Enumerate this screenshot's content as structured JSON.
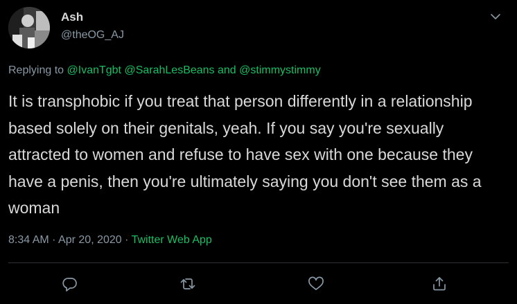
{
  "user": {
    "display_name": "Ash",
    "handle": "@theOG_AJ"
  },
  "reply_context": {
    "prefix": "Replying to ",
    "mention_1": "@IvanTgbt",
    "mention_2": "@SarahLesBeans",
    "conjunction": " and ",
    "mention_3": "@stimmystimmy"
  },
  "tweet": {
    "text": "It is transphobic if you treat that person differently in a relationship based solely on their genitals, yeah. If you say you're sexually attracted to women and refuse to have sex with one because they have a penis, then you're ultimately saying you don't see them as a woman",
    "time": "8:34 AM",
    "separator_1": " · ",
    "date": "Apr 20, 2020",
    "separator_2": " · ",
    "source": "Twitter Web App"
  },
  "icons": {
    "caret": "chevron-down-icon",
    "reply": "reply-bubble-icon",
    "retweet": "retweet-icon",
    "like": "heart-icon",
    "share": "share-upload-icon"
  },
  "colors": {
    "background": "#000000",
    "text": "#d9d9d9",
    "muted": "#8899a6",
    "accent": "#17bf63",
    "divider": "#2f3336"
  }
}
